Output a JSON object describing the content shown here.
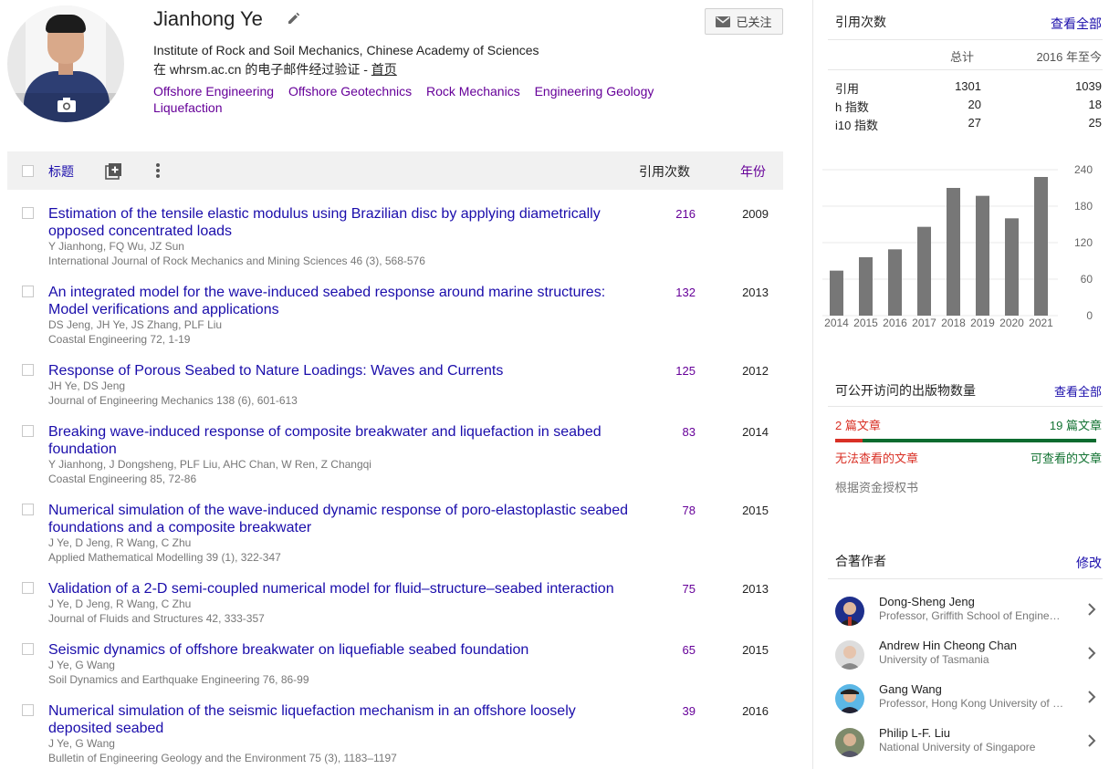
{
  "profile": {
    "name": "Jianhong Ye",
    "affiliation": "Institute of Rock and Soil Mechanics, Chinese Academy of Sciences",
    "verified_prefix": "在 whrsm.ac.cn 的电子邮件经过验证 - ",
    "homepage_label": "首页",
    "follow_label": "已关注",
    "interests": [
      "Offshore Engineering",
      "Offshore Geotechnics",
      "Rock Mechanics",
      "Engineering Geology",
      "Liquefaction"
    ]
  },
  "table": {
    "title_header": "标题",
    "citations_header": "引用次数",
    "year_header": "年份",
    "rows": [
      {
        "title": "Estimation of the tensile elastic modulus using Brazilian disc by applying diametrically opposed concentrated loads",
        "authors": "Y Jianhong, FQ Wu, JZ Sun",
        "venue": "International Journal of Rock Mechanics and Mining Sciences 46 (3), 568-576",
        "citations": "216",
        "year": "2009"
      },
      {
        "title": "An integrated model for the wave-induced seabed response around marine structures: Model verifications and applications",
        "authors": "DS Jeng, JH Ye, JS Zhang, PLF Liu",
        "venue": "Coastal Engineering 72, 1-19",
        "citations": "132",
        "year": "2013"
      },
      {
        "title": "Response of Porous Seabed to Nature Loadings: Waves and Currents",
        "authors": "JH Ye, DS Jeng",
        "venue": "Journal of Engineering Mechanics 138 (6), 601-613",
        "citations": "125",
        "year": "2012"
      },
      {
        "title": "Breaking wave-induced response of composite breakwater and liquefaction in seabed foundation",
        "authors": "Y Jianhong, J Dongsheng, PLF Liu, AHC Chan, W Ren, Z Changqi",
        "venue": "Coastal Engineering 85, 72-86",
        "citations": "83",
        "year": "2014"
      },
      {
        "title": "Numerical simulation of the wave-induced dynamic response of poro-elastoplastic seabed foundations and a composite breakwater",
        "authors": "J Ye, D Jeng, R Wang, C Zhu",
        "venue": "Applied Mathematical Modelling 39 (1), 322-347",
        "citations": "78",
        "year": "2015"
      },
      {
        "title": "Validation of a 2-D semi-coupled numerical model for fluid–structure–seabed interaction",
        "authors": "J Ye, D Jeng, R Wang, C Zhu",
        "venue": "Journal of Fluids and Structures 42, 333-357",
        "citations": "75",
        "year": "2013"
      },
      {
        "title": "Seismic dynamics of offshore breakwater on liquefiable seabed foundation",
        "authors": "J Ye, G Wang",
        "venue": "Soil Dynamics and Earthquake Engineering 76, 86-99",
        "citations": "65",
        "year": "2015"
      },
      {
        "title": "Numerical simulation of the seismic liquefaction mechanism in an offshore loosely deposited seabed",
        "authors": "J Ye, G Wang",
        "venue": "Bulletin of Engineering Geology and the Environment 75 (3), 1183–1197",
        "citations": "39",
        "year": "2016"
      }
    ]
  },
  "sidebar": {
    "citations_title": "引用次数",
    "view_all": "查看全部",
    "col_total": "总计",
    "col_since": "2016 年至今",
    "stats": [
      {
        "label": "引用",
        "total": "1301",
        "since": "1039"
      },
      {
        "label": "h 指数",
        "total": "20",
        "since": "18"
      },
      {
        "label": "i10 指数",
        "total": "27",
        "since": "25"
      }
    ],
    "open_access_title": "可公开访问的出版物数量",
    "open_access_view_all": "查看全部",
    "unavailable_count": "2 篇文章",
    "available_count": "19 篇文章",
    "unavailable_label": "无法查看的文章",
    "available_label": "可查看的文章",
    "mandate_note": "根据资金授权书",
    "coauthors_title": "合著作者",
    "coauthors_edit": "修改",
    "coauthors": [
      {
        "name": "Dong-Sheng Jeng",
        "affiliation": "Professor, Griffith School of Engineering"
      },
      {
        "name": "Andrew Hin Cheong Chan",
        "affiliation": "University of Tasmania"
      },
      {
        "name": "Gang Wang",
        "affiliation": "Professor, Hong Kong University of Science and Technology"
      },
      {
        "name": "Philip L-F. Liu",
        "affiliation": "National University of Singapore"
      }
    ]
  },
  "chart_data": {
    "type": "bar",
    "categories": [
      "2014",
      "2015",
      "2016",
      "2017",
      "2018",
      "2019",
      "2020",
      "2021"
    ],
    "values": [
      74,
      96,
      109,
      146,
      210,
      197,
      160,
      228
    ],
    "ylim": [
      0,
      240
    ],
    "yticks": [
      "0",
      "60",
      "120",
      "180",
      "240"
    ],
    "bar_color": "#777777"
  }
}
